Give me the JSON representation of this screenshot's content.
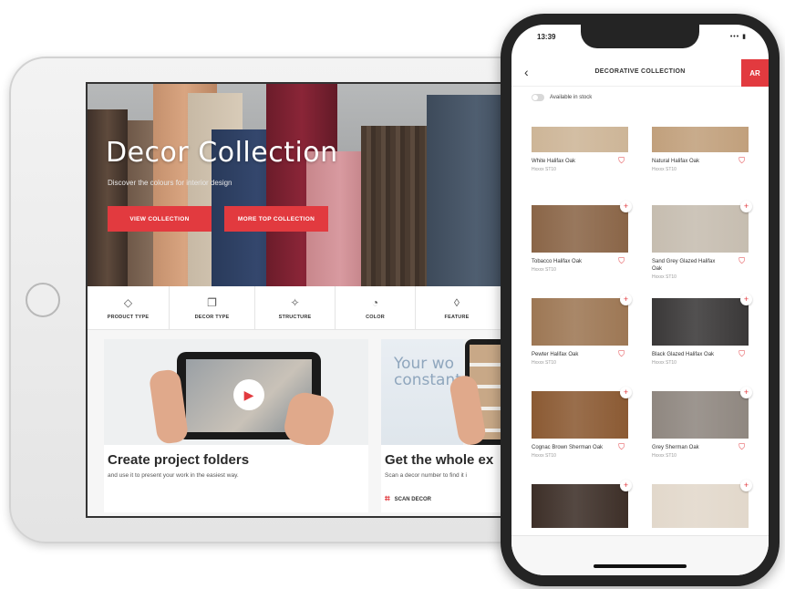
{
  "tablet": {
    "hero": {
      "title": "Decor Collection",
      "subtitle": "Discover the colours for interior design",
      "buttons": [
        "VIEW COLLECTION",
        "MORE TOP COLLECTION"
      ]
    },
    "categories": [
      {
        "label": "PRODUCT TYPE",
        "icon": "layers-icon",
        "glyph": "◇"
      },
      {
        "label": "DECOR TYPE",
        "icon": "stack-icon",
        "glyph": "❐"
      },
      {
        "label": "STRUCTURE",
        "icon": "sparkle-icon",
        "glyph": "✧"
      },
      {
        "label": "COLOR",
        "icon": "palette-icon",
        "glyph": "◔"
      },
      {
        "label": "FEATURE",
        "icon": "drop-icon",
        "glyph": "◊"
      }
    ],
    "cards": [
      {
        "title": "Create project folders",
        "subtitle": "and use it to present your work in the easiest way."
      },
      {
        "title": "Get the whole ex",
        "subtitle": "Scan a decor number to find it i",
        "wall_text": "Your wo constant",
        "link": "SCAN DECOR"
      }
    ]
  },
  "phone": {
    "status": {
      "time": "13:39",
      "icons": "••• ▮"
    },
    "header": {
      "title": "DECORATIVE COLLECTION",
      "action": "AR"
    },
    "filter": {
      "label": "Available in stock"
    },
    "decors": [
      {
        "name": "White Halifax Oak",
        "sub": "Hxxxx ST10",
        "color": "#cdb597",
        "plus": false
      },
      {
        "name": "Natural Halifax Oak",
        "sub": "Hxxxx ST10",
        "color": "#c1a07c",
        "plus": false
      },
      {
        "name": "Tobacco Halifax Oak",
        "sub": "Hxxxx ST10",
        "color": "#8a6547",
        "plus": true
      },
      {
        "name": "Sand Grey Glazed Halifax Oak",
        "sub": "Hxxxx ST10",
        "color": "#c6bdb0",
        "plus": true
      },
      {
        "name": "Pewter Halifax Oak",
        "sub": "Hxxxx ST10",
        "color": "#9d7754",
        "plus": true
      },
      {
        "name": "Black Glazed Halifax Oak",
        "sub": "Hxxxx ST10",
        "color": "#3a3838",
        "plus": true
      },
      {
        "name": "Cognac Brown Sherman Oak",
        "sub": "Hxxxx ST10",
        "color": "#8b5a33",
        "plus": true
      },
      {
        "name": "Grey Sherman Oak",
        "sub": "Hxxxx ST10",
        "color": "#8f8780",
        "plus": true
      },
      {
        "name": "",
        "sub": "",
        "color": "#3d2f28",
        "plus": true
      },
      {
        "name": "",
        "sub": "",
        "color": "#e2d8cb",
        "plus": true
      }
    ]
  },
  "colors": {
    "accent": "#e23a3f"
  }
}
